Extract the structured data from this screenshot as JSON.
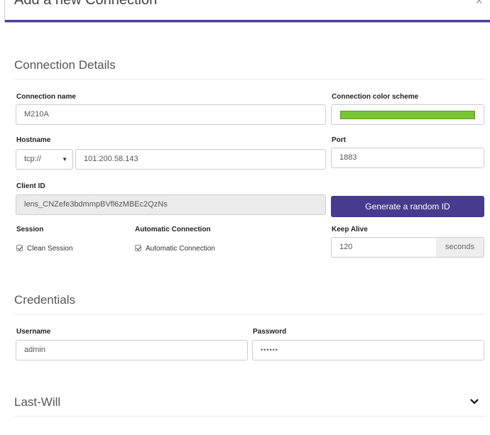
{
  "dialog": {
    "title": "Add a new Connection",
    "close_glyph": "×"
  },
  "details": {
    "section_title": "Connection Details",
    "connection_name": {
      "label": "Connection name",
      "value": "M210A"
    },
    "color_scheme": {
      "label": "Connection color scheme",
      "color": "#76c432"
    },
    "hostname": {
      "label": "Hostname",
      "protocol": "tcp://",
      "value": "101.200.58.143"
    },
    "port": {
      "label": "Port",
      "value": "1883"
    },
    "client_id": {
      "label": "Client ID",
      "value": "lens_CNZefe3bdmmpBVfl6zMBEc2QzNs"
    },
    "generate_button": "Generate a random ID",
    "session": {
      "label": "Session",
      "checkbox_label": "Clean Session",
      "checked": true
    },
    "automatic_connection": {
      "label": "Automatic Connection",
      "checkbox_label": "Automatic Connection",
      "checked": true
    },
    "keep_alive": {
      "label": "Keep Alive",
      "value": "120",
      "unit": "seconds"
    }
  },
  "credentials": {
    "section_title": "Credentials",
    "username": {
      "label": "Username",
      "value": "admin"
    },
    "password": {
      "label": "Password",
      "value": "••••••"
    }
  },
  "last_will": {
    "section_title": "Last-Will"
  },
  "theme": {
    "accent": "#473b8f",
    "header_rule": "#4a3f99"
  }
}
